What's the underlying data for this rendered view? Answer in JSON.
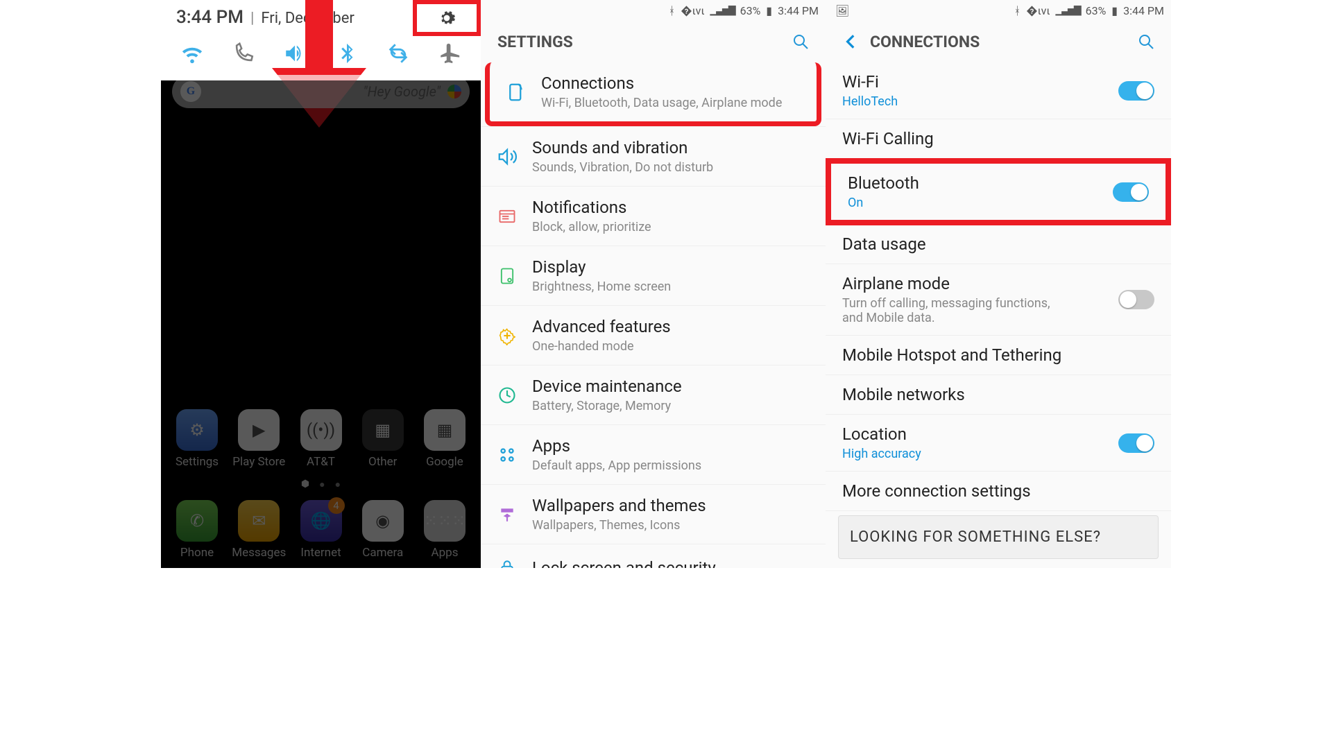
{
  "status": {
    "battery_pct": "63%",
    "time": "3:44 PM"
  },
  "pane1": {
    "time": "3:44 PM",
    "date": "Fri, December",
    "search_placeholder": "\"Hey Google\"",
    "apps_row1": [
      {
        "label": "Settings"
      },
      {
        "label": "Play Store"
      },
      {
        "label": "AT&T"
      },
      {
        "label": "Other"
      },
      {
        "label": "Google"
      }
    ],
    "dock": [
      {
        "label": "Phone"
      },
      {
        "label": "Messages"
      },
      {
        "label": "Internet",
        "badge": "4"
      },
      {
        "label": "Camera"
      },
      {
        "label": "Apps"
      }
    ]
  },
  "pane2": {
    "title": "SETTINGS",
    "items": [
      {
        "title": "Connections",
        "sub": "Wi-Fi, Bluetooth, Data usage, Airplane mode",
        "icon": "conn",
        "highlight": true
      },
      {
        "title": "Sounds and vibration",
        "sub": "Sounds, Vibration, Do not disturb",
        "icon": "sound"
      },
      {
        "title": "Notifications",
        "sub": "Block, allow, prioritize",
        "icon": "notif"
      },
      {
        "title": "Display",
        "sub": "Brightness, Home screen",
        "icon": "display"
      },
      {
        "title": "Advanced features",
        "sub": "One-handed mode",
        "icon": "adv"
      },
      {
        "title": "Device maintenance",
        "sub": "Battery, Storage, Memory",
        "icon": "maint"
      },
      {
        "title": "Apps",
        "sub": "Default apps, App permissions",
        "icon": "apps"
      },
      {
        "title": "Wallpapers and themes",
        "sub": "Wallpapers, Themes, Icons",
        "icon": "wall"
      },
      {
        "title": "Lock screen and security",
        "sub": "",
        "icon": "lock"
      }
    ]
  },
  "pane3": {
    "title": "CONNECTIONS",
    "items": [
      {
        "title": "Wi-Fi",
        "sub": "HelloTech",
        "sub_accent": true,
        "toggle": "on"
      },
      {
        "title": "Wi-Fi Calling"
      },
      {
        "title": "Bluetooth",
        "sub": "On",
        "sub_accent": true,
        "toggle": "on",
        "highlight": true
      },
      {
        "title": "Data usage"
      },
      {
        "title": "Airplane mode",
        "sub": "Turn off calling, messaging functions, and Mobile data.",
        "toggle": "off"
      },
      {
        "title": "Mobile Hotspot and Tethering"
      },
      {
        "title": "Mobile networks"
      },
      {
        "title": "Location",
        "sub": "High accuracy",
        "sub_accent": true,
        "toggle": "on"
      },
      {
        "title": "More connection settings"
      }
    ],
    "footer": "LOOKING FOR SOMETHING ELSE?"
  }
}
